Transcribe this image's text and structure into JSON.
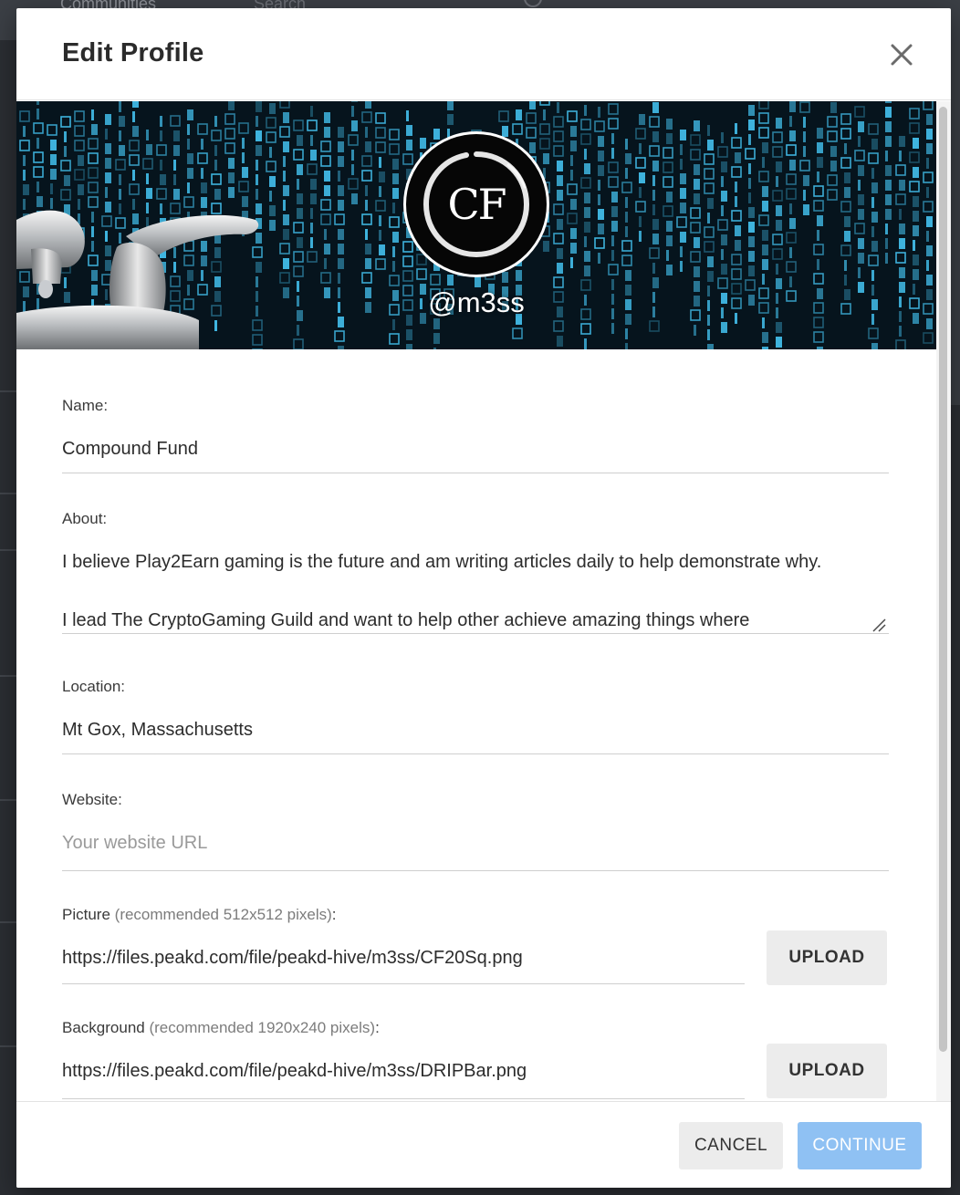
{
  "background_app": {
    "nav_label": "Communities",
    "search_placeholder": "Search"
  },
  "modal": {
    "title": "Edit Profile",
    "profile": {
      "avatar_initials": "CF",
      "handle": "@m3ss"
    },
    "fields": {
      "name": {
        "label": "Name:",
        "value": "Compound Fund"
      },
      "about": {
        "label": "About:",
        "line1": "I believe Play2Earn gaming is the future and am writing articles daily to help demonstrate why.",
        "line2": "I lead The CryptoGaming Guild and want to help other achieve amazing things where"
      },
      "location": {
        "label": "Location:",
        "value": "Mt Gox, Massachusetts"
      },
      "website": {
        "label": "Website:",
        "value": "",
        "placeholder": "Your website URL"
      },
      "picture": {
        "label": "Picture",
        "hint": "(recommended 512x512 pixels)",
        "suffix": ":",
        "value": "https://files.peakd.com/file/peakd-hive/m3ss/CF20Sq.png",
        "upload_label": "UPLOAD"
      },
      "background": {
        "label": "Background",
        "hint": "(recommended 1920x240 pixels)",
        "suffix": ":",
        "value": "https://files.peakd.com/file/peakd-hive/m3ss/DRIPBar.png",
        "upload_label": "UPLOAD"
      }
    },
    "footer": {
      "cancel_label": "CANCEL",
      "continue_label": "CONTINUE"
    }
  },
  "colors": {
    "continue_button": "#8fc1f3",
    "banner_glyph": "#3fb5e0",
    "overlay": "#2b2e33"
  }
}
